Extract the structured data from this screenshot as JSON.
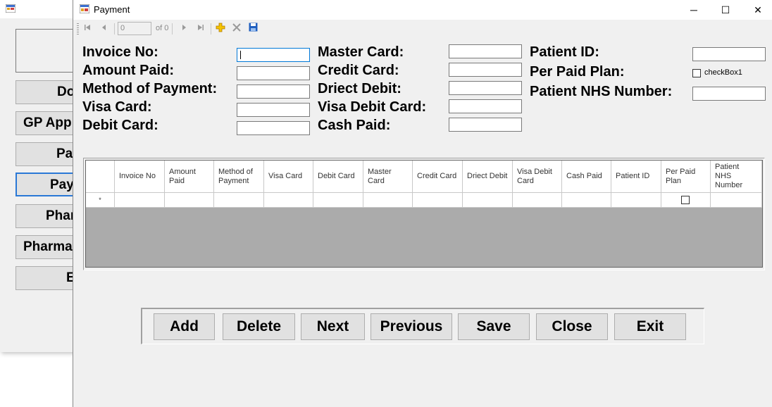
{
  "background_window": {
    "buttons": [
      "Do",
      "GP App",
      "Pa",
      "Pay",
      "Phar",
      "Pharma",
      "E"
    ]
  },
  "window": {
    "title": "Payment",
    "controls": {
      "minimize": "─",
      "maximize": "☐",
      "close": "✕"
    }
  },
  "navigator": {
    "position": "0",
    "count_label": "of 0",
    "icons": [
      "move-first-icon",
      "move-previous-icon",
      "move-next-icon",
      "move-last-icon",
      "add-new-icon",
      "delete-icon",
      "save-icon"
    ]
  },
  "form": {
    "invoice_no": {
      "label": "Invoice No:",
      "value": ""
    },
    "amount_paid": {
      "label": "Amount Paid:",
      "value": ""
    },
    "method_of_payment": {
      "label": "Method of Payment:",
      "value": ""
    },
    "visa_card": {
      "label": "Visa Card:",
      "value": ""
    },
    "debit_card": {
      "label": "Debit Card:",
      "value": ""
    },
    "master_card": {
      "label": "Master Card:",
      "value": ""
    },
    "credit_card": {
      "label": "Credit Card:",
      "value": ""
    },
    "driect_debit": {
      "label": "Driect Debit:",
      "value": ""
    },
    "visa_debit_card": {
      "label": "Visa Debit Card:",
      "value": ""
    },
    "cash_paid": {
      "label": "Cash Paid:",
      "value": ""
    },
    "patient_id": {
      "label": "Patient ID:",
      "value": ""
    },
    "per_paid_plan": {
      "label": "Per Paid Plan:",
      "checkbox_label": "checkBox1",
      "checked": false
    },
    "patient_nhs_number": {
      "label": "Patient NHS Number:",
      "value": ""
    }
  },
  "grid": {
    "new_row_marker": "*",
    "columns": [
      "Invoice No",
      "Amount Paid",
      "Method of Payment",
      "Visa Card",
      "Debit Card",
      "Master Card",
      "Credit Card",
      "Driect Debit",
      "Visa Debit Card",
      "Cash Paid",
      "Patient ID",
      "Per Paid Plan",
      "Patient NHS Number"
    ]
  },
  "buttons": {
    "add": "Add",
    "delete": "Delete",
    "next": "Next",
    "previous": "Previous",
    "save": "Save",
    "close": "Close",
    "exit": "Exit"
  }
}
